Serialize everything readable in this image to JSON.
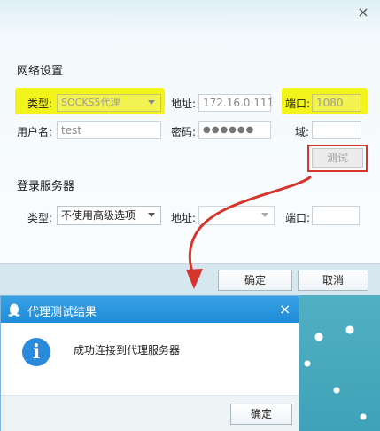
{
  "main_window": {
    "close_glyph": "×",
    "network": {
      "title": "网络设置",
      "type_label": "类型:",
      "type_value": "SOCKS5代理",
      "address_label": "地址:",
      "address_value": "172.16.0.111",
      "port_label": "端口:",
      "port_value": "1080",
      "username_label": "用户名:",
      "username_value": "test",
      "password_label": "密码:",
      "password_value": "●●●●●●",
      "domain_label": "域:",
      "domain_value": "",
      "test_label": "测试"
    },
    "login_server": {
      "title": "登录服务器",
      "type_label": "类型:",
      "type_value": "不使用高级选项",
      "address_label": "地址:",
      "address_value": "",
      "port_label": "端口:",
      "port_value": ""
    },
    "ok_label": "确定",
    "cancel_label": "取消"
  },
  "dialog": {
    "title": "代理测试结果",
    "close_glyph": "×",
    "info_glyph": "i",
    "message": "成功连接到代理服务器",
    "ok_label": "确定"
  },
  "colors": {
    "highlight": "#f4f41d",
    "annotation_red": "#d4352d",
    "title_bar_blue": "#1f8cd8"
  }
}
